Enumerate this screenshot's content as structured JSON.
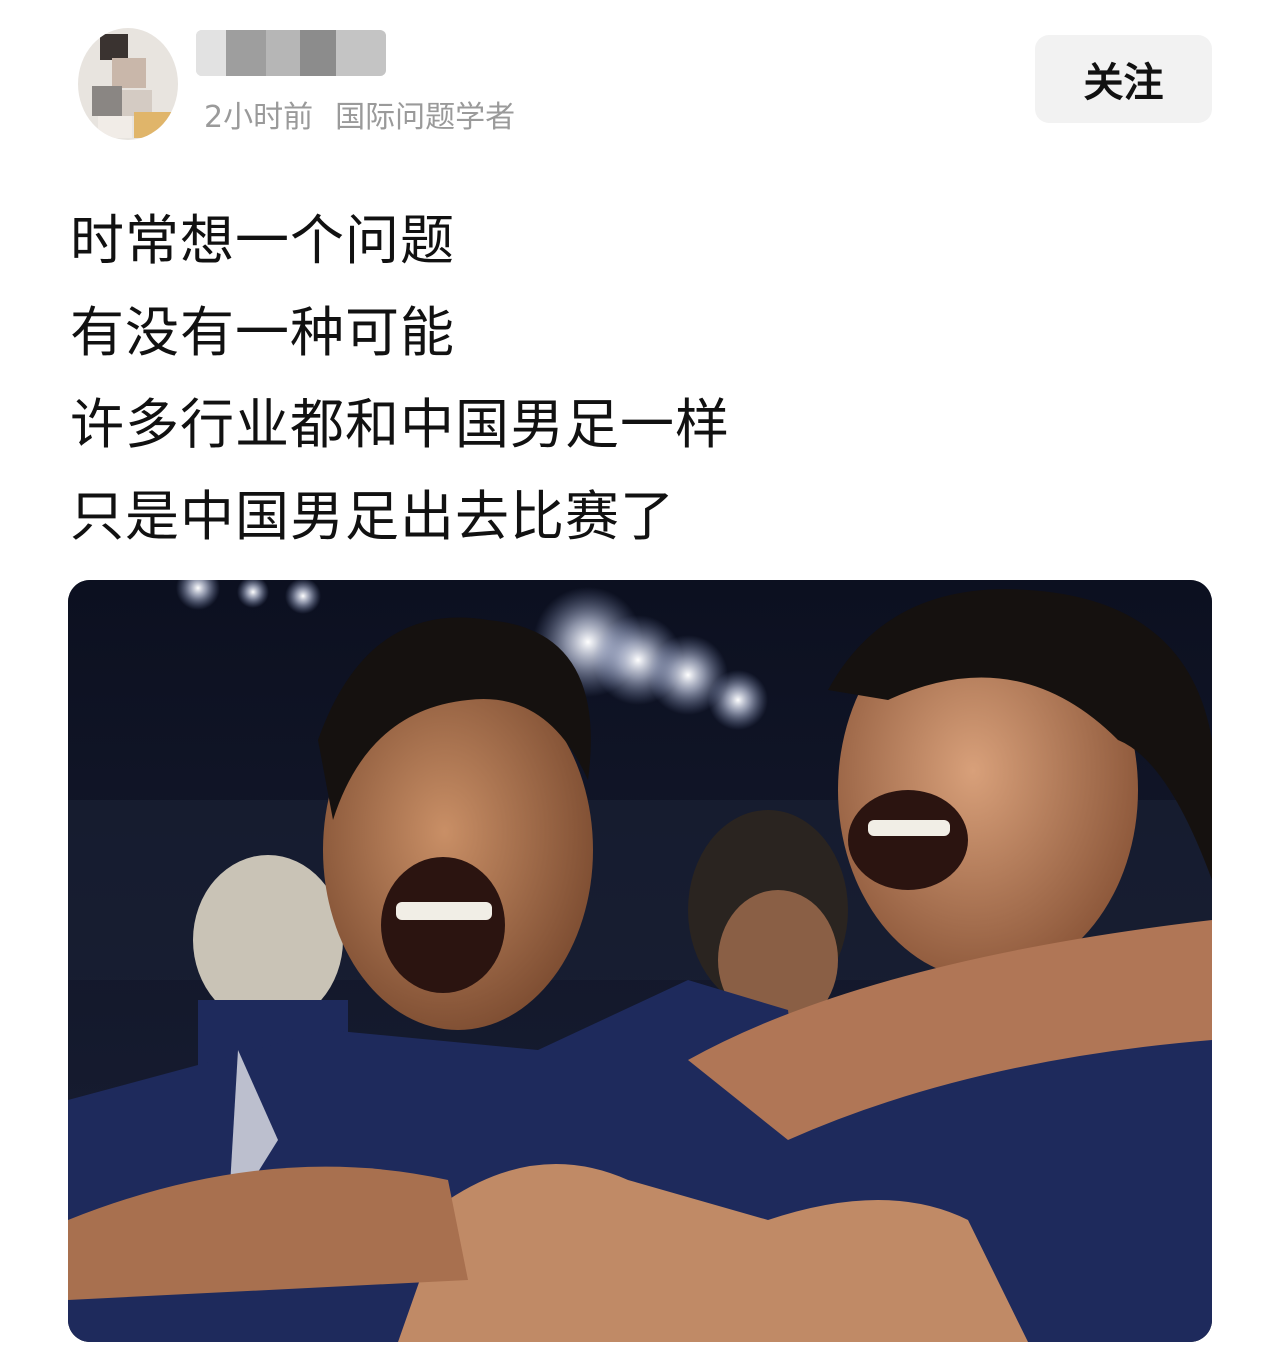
{
  "author": {
    "avatar_icon": "user-avatar-icon",
    "username": "",
    "time_ago": "2小时前",
    "title": "国际问题学者"
  },
  "follow_button": {
    "label": "关注"
  },
  "post": {
    "lines": [
      "时常想一个问题",
      "有没有一种可能",
      "许多行业都和中国男足一样",
      "只是中国男足出去比赛了"
    ]
  },
  "image": {
    "subject_icon": "photo-icon"
  },
  "colors": {
    "meta_text": "#9a9a9a",
    "follow_bg": "#f2f2f2",
    "jersey": "#1e2a5c"
  }
}
